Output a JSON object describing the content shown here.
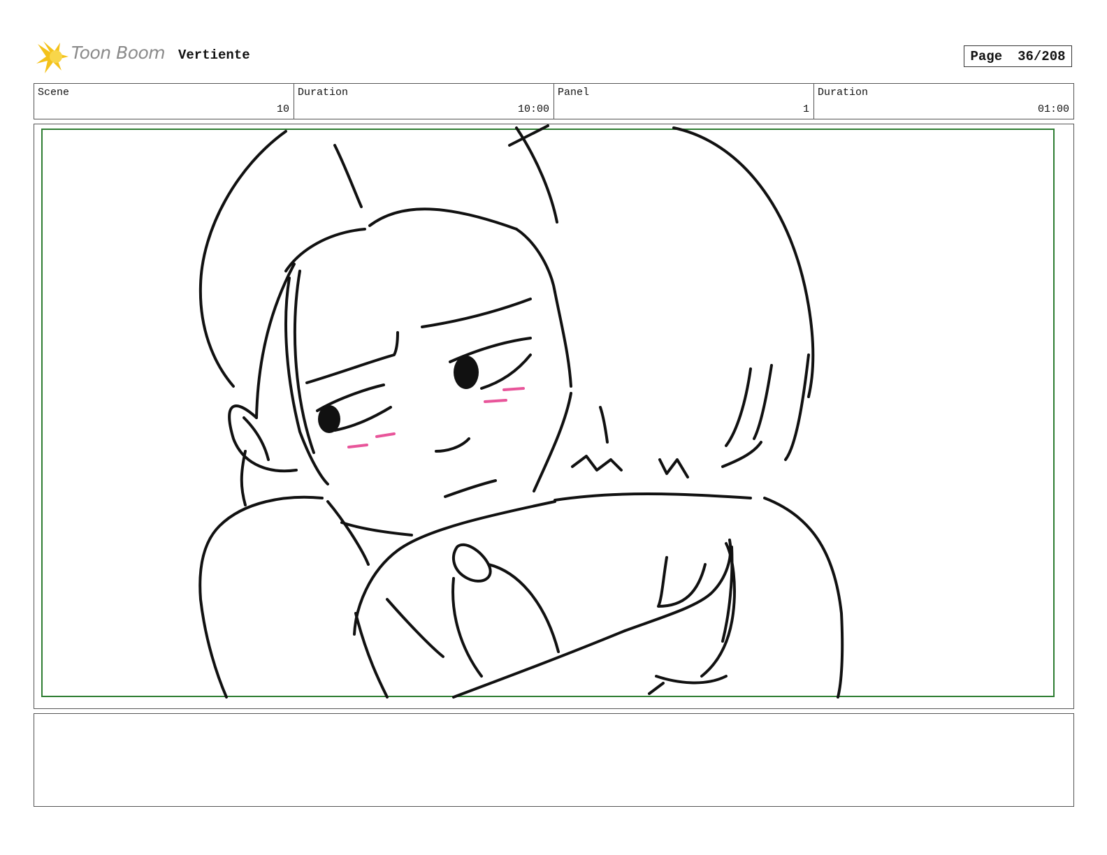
{
  "header": {
    "logo_text": "Toon Boom",
    "project_title": "Vertiente",
    "page_label": "Page",
    "page_value": "36/208"
  },
  "info": {
    "scene_label": "Scene",
    "scene_value": "10",
    "scene_duration_label": "Duration",
    "scene_duration_value": "10:00",
    "panel_label": "Panel",
    "panel_value": "1",
    "panel_duration_label": "Duration",
    "panel_duration_value": "01:00"
  },
  "colors": {
    "safe_frame": "#2e7d32",
    "blush": "#e8559a",
    "line": "#111111",
    "logo_burst": "#f4c21b"
  },
  "notes": {
    "text": ""
  }
}
